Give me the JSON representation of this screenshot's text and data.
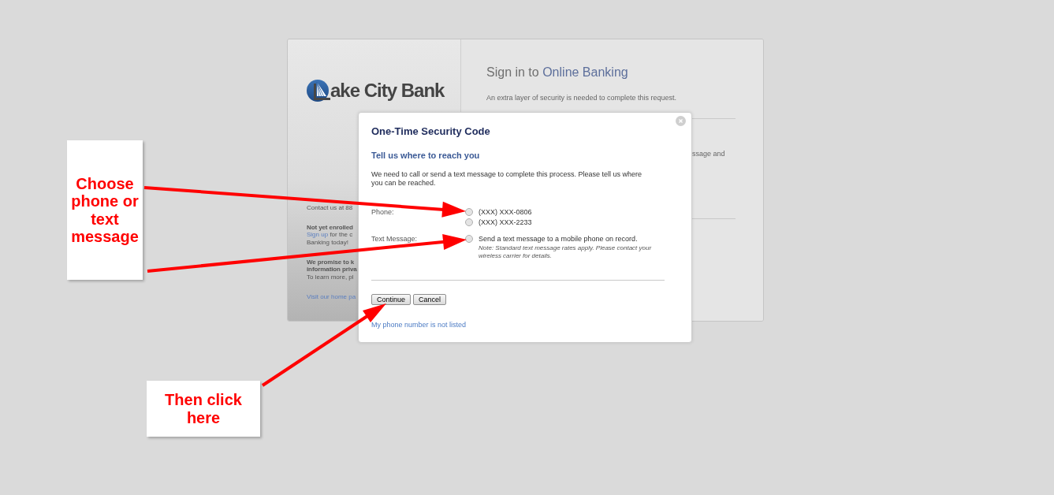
{
  "sidebar": {
    "logo_text": "ake City Bank",
    "sections": [
      {
        "lines": [
          {
            "kind": "text",
            "text": "Contact us at 88"
          }
        ]
      },
      {
        "lines": [
          {
            "kind": "heading",
            "text": "Not yet enrolled"
          },
          {
            "kind": "mixed",
            "link": "Sign up",
            "text": "for the c"
          },
          {
            "kind": "text",
            "text": "Banking today!"
          }
        ]
      },
      {
        "lines": [
          {
            "kind": "heading",
            "text": "We promise to k"
          },
          {
            "kind": "heading",
            "text": "information priva"
          },
          {
            "kind": "text",
            "text": "To learn more, pl"
          }
        ]
      },
      {
        "lines": [
          {
            "kind": "link",
            "text": "Visit our home pa"
          }
        ]
      }
    ]
  },
  "sign_in": {
    "title_lead": "Sign in to",
    "title_brand": "Online Banking",
    "subtitle": "An extra layer of security is needed to complete this request.",
    "partial_text": "ssage and"
  },
  "dialog": {
    "title": "One-Time Security Code",
    "subtitle": "Tell us where to reach you",
    "message": "We need to call or send a text message to complete this process. Please tell us where you can be reached.",
    "fields": [
      {
        "label": "Phone:",
        "options": [
          {
            "text": "(XXX) XXX-0806",
            "selected": false
          },
          {
            "text": "(XXX) XXX-2233",
            "selected": false
          }
        ]
      },
      {
        "label": "Text Message:",
        "options": [
          {
            "text": "Send a text message to a mobile phone on record.",
            "selected": false,
            "note": "Note: Standard text message rates apply. Please contact your wireless carrier for details."
          }
        ]
      }
    ],
    "buttons": [
      "Continue",
      "Cancel"
    ],
    "link": "My phone number is not listed"
  },
  "annotations": [
    {
      "text": "Choose phone or text message"
    },
    {
      "text": "Then click here"
    }
  ]
}
